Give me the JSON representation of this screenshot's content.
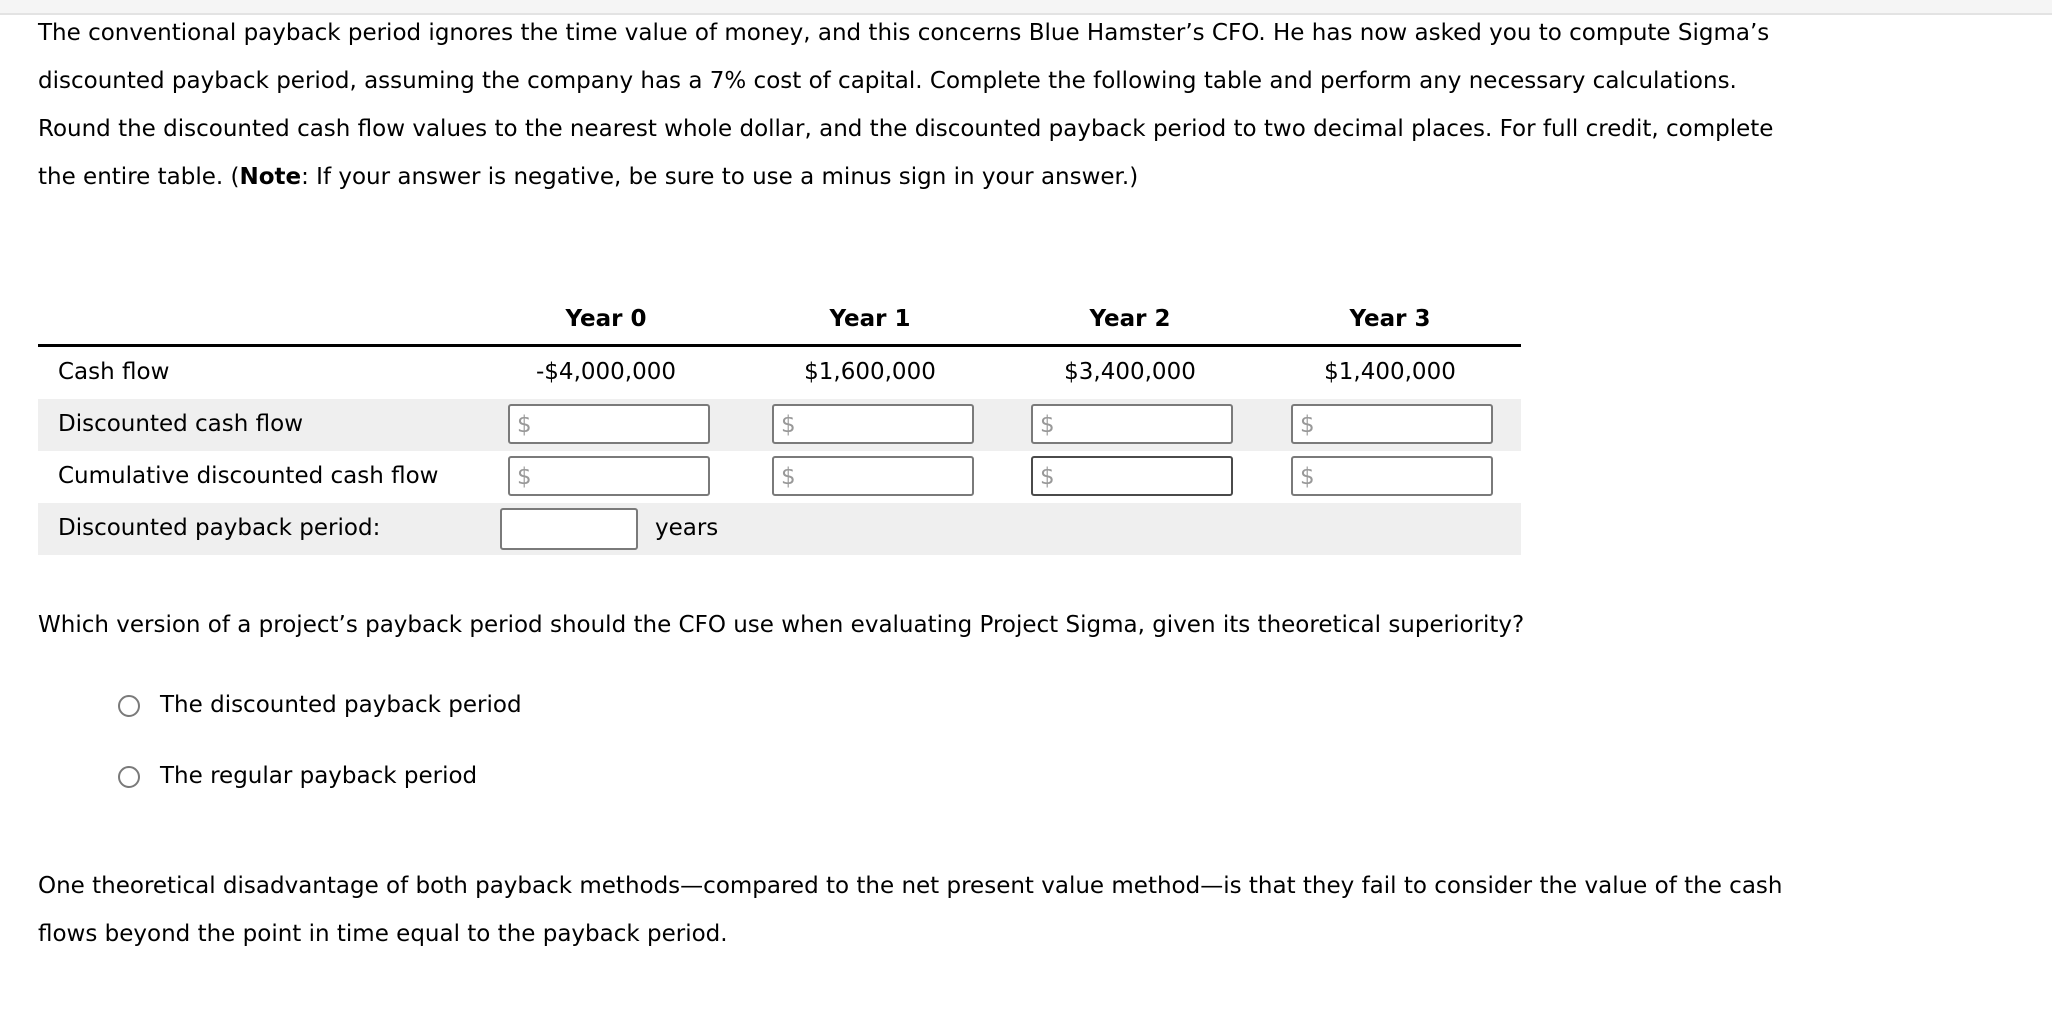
{
  "intro": {
    "line1": "The conventional payback period ignores the time value of money, and this concerns Blue Hamster’s CFO. He has now asked you to compute Sigma’s",
    "line2": "discounted payback period, assuming the company has a 7% cost of capital. Complete the following table and perform any necessary calculations.",
    "line3": "Round the discounted cash flow values to the nearest whole dollar, and the discounted payback period to two decimal places. For full credit, complete",
    "line4_pre": "the entire table. (",
    "line4_bold": "Note",
    "line4_post": ": If your answer is negative, be sure to use a minus sign in your answer.)"
  },
  "table": {
    "headers": [
      "Year 0",
      "Year 1",
      "Year 2",
      "Year 3"
    ],
    "rows": {
      "cash_flow": {
        "label": "Cash flow",
        "values": [
          "-$4,000,000",
          "$1,600,000",
          "$3,400,000",
          "$1,400,000"
        ]
      },
      "discounted_cash_flow": {
        "label": "Discounted cash flow",
        "currency_symbol": "$",
        "values": [
          "",
          "",
          "",
          ""
        ]
      },
      "cumulative_discounted_cash_flow": {
        "label": "Cumulative discounted cash flow",
        "currency_symbol": "$",
        "values": [
          "",
          "",
          "",
          ""
        ]
      },
      "discounted_payback_period": {
        "label": "Discounted payback period:",
        "value": "",
        "unit": "years"
      }
    }
  },
  "question": {
    "text": "Which version of a project’s payback period should the CFO use when evaluating Project Sigma, given its theoretical superiority?",
    "options": [
      {
        "label": "The discounted payback period",
        "selected": false
      },
      {
        "label": "The regular payback period",
        "selected": false
      }
    ]
  },
  "conclusion": {
    "line1": "One theoretical disadvantage of both payback methods—compared to the net present value method—is that they fail to consider the value of the cash",
    "line2": "flows beyond the point in time equal to the payback period."
  }
}
